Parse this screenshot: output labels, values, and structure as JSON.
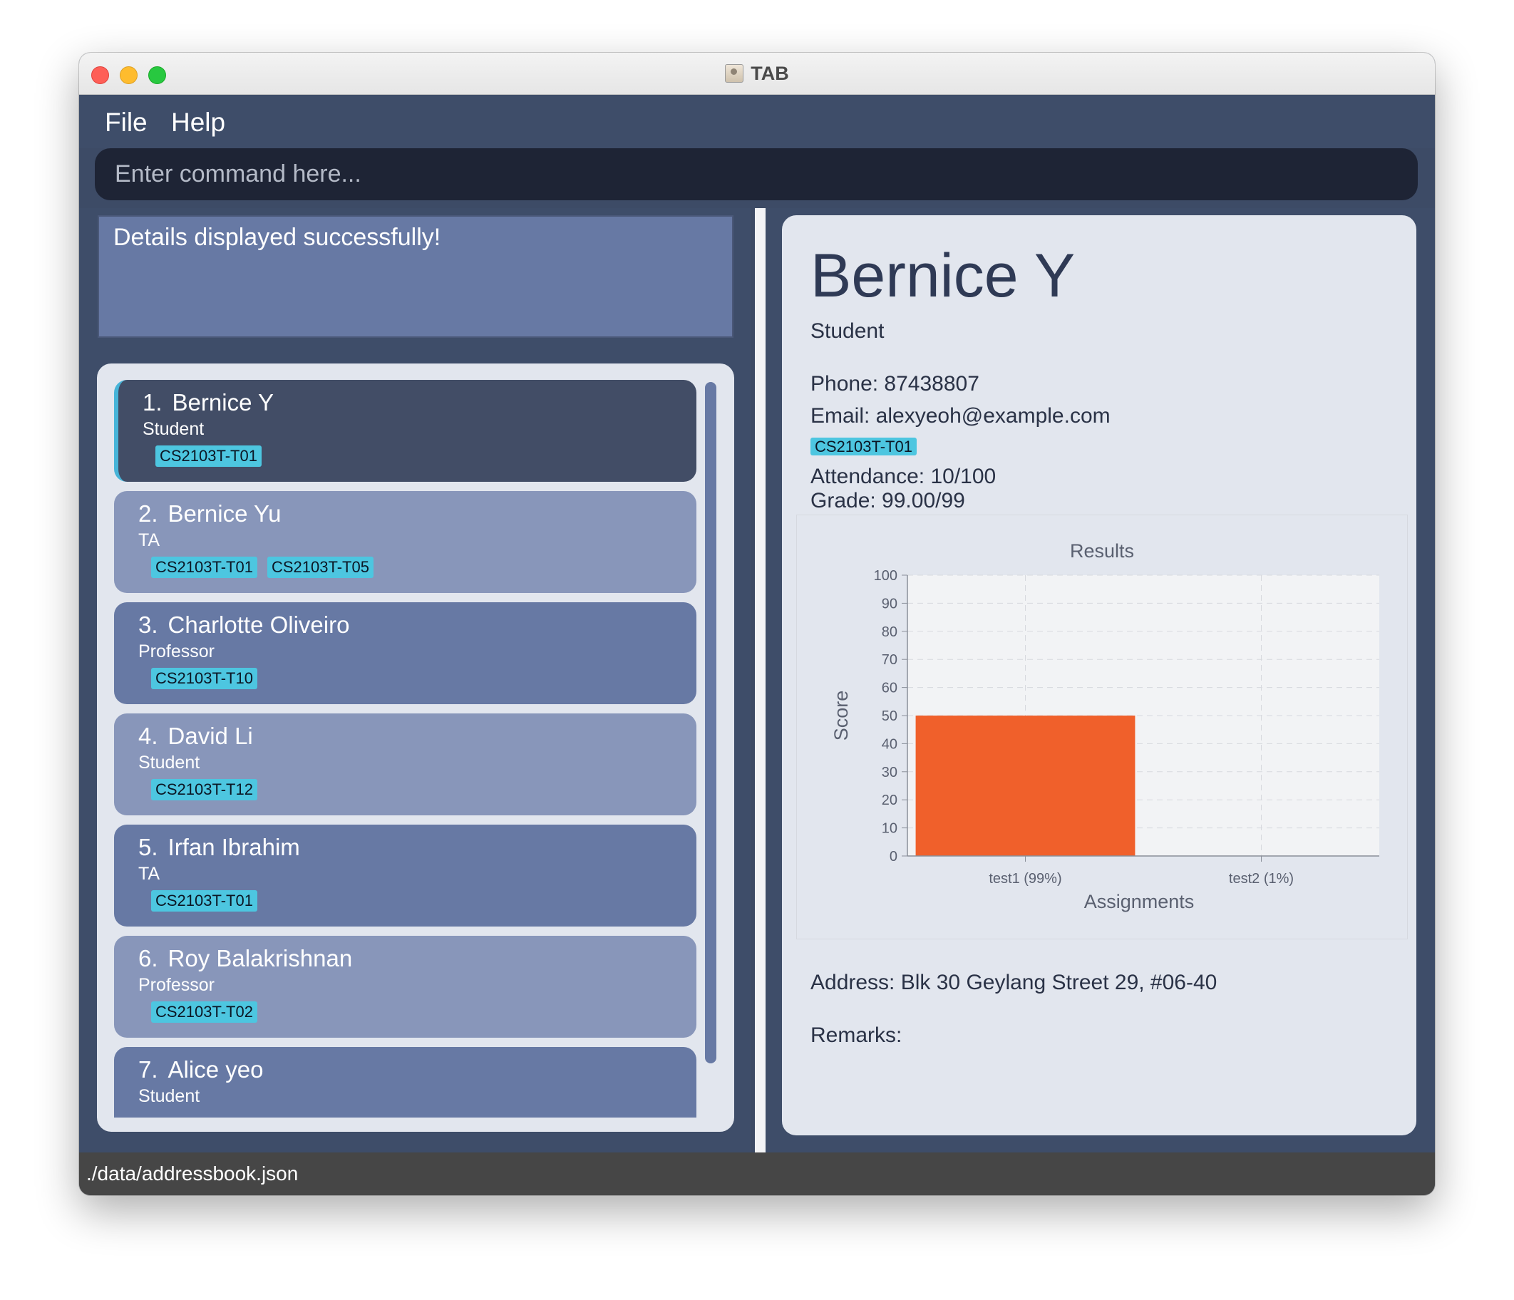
{
  "window": {
    "title": "TAB"
  },
  "menu": {
    "file": "File",
    "help": "Help"
  },
  "command": {
    "placeholder": "Enter command here..."
  },
  "result": {
    "message": "Details displayed successfully!"
  },
  "persons": [
    {
      "index": "1.",
      "name": "Bernice Y",
      "role": "Student",
      "tags": [
        "CS2103T-T01"
      ]
    },
    {
      "index": "2.",
      "name": "Bernice Yu",
      "role": "TA",
      "tags": [
        "CS2103T-T01",
        "CS2103T-T05"
      ]
    },
    {
      "index": "3.",
      "name": "Charlotte Oliveiro",
      "role": "Professor",
      "tags": [
        "CS2103T-T10"
      ]
    },
    {
      "index": "4.",
      "name": "David Li",
      "role": "Student",
      "tags": [
        "CS2103T-T12"
      ]
    },
    {
      "index": "5.",
      "name": "Irfan Ibrahim",
      "role": "TA",
      "tags": [
        "CS2103T-T01"
      ]
    },
    {
      "index": "6.",
      "name": "Roy Balakrishnan",
      "role": "Professor",
      "tags": [
        "CS2103T-T02"
      ]
    },
    {
      "index": "7.",
      "name": "Alice yeo",
      "role": "Student",
      "tags": []
    }
  ],
  "details": {
    "name": "Bernice Y",
    "role": "Student",
    "phone": "Phone: 87438807",
    "email": "Email: alexyeoh@example.com",
    "tag": "CS2103T-T01",
    "attendance": "Attendance: 10/100",
    "grade": "Grade: 99.00/99",
    "address": "Address: Blk 30 Geylang Street 29, #06-40",
    "remarks": "Remarks:"
  },
  "chart_data": {
    "type": "bar",
    "title": "Results",
    "xlabel": "Assignments",
    "ylabel": "Score",
    "categories": [
      "test1 (99%)",
      "test2 (1%)"
    ],
    "values": [
      50,
      0
    ],
    "ylim": [
      0,
      100
    ],
    "yticks": [
      0,
      10,
      20,
      30,
      40,
      50,
      60,
      70,
      80,
      90,
      100
    ],
    "grid": true,
    "bar_color": "#f0602b"
  },
  "status": {
    "path": "./data/addressbook.json"
  },
  "colors": {
    "accent_tag": "#4dc6e0",
    "selected_card": "#424d66",
    "card_light": "#8896ba",
    "card_dark": "#6779a4"
  }
}
